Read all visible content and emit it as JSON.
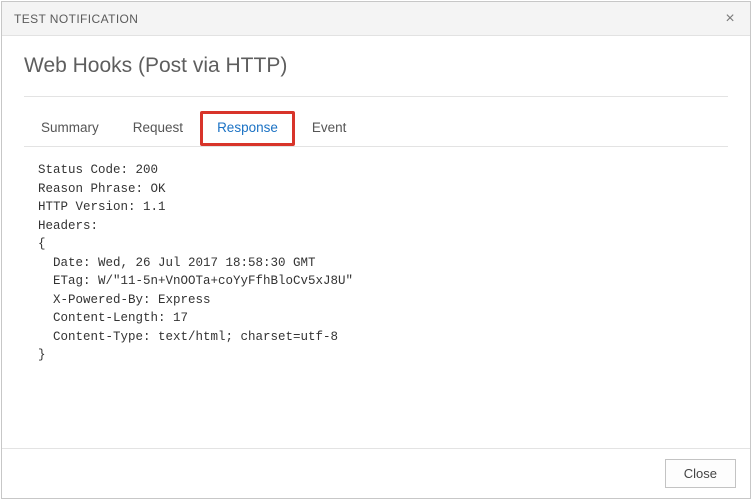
{
  "dialog": {
    "title": "TEST NOTIFICATION",
    "close_glyph": "×",
    "heading": "Web Hooks (Post via HTTP)"
  },
  "tabs": {
    "items": [
      "Summary",
      "Request",
      "Response",
      "Event"
    ],
    "active_index": 2
  },
  "response": {
    "lines": [
      "Status Code: 200",
      "Reason Phrase: OK",
      "HTTP Version: 1.1",
      "Headers:",
      "{",
      "  Date: Wed, 26 Jul 2017 18:58:30 GMT",
      "  ETag: W/\"11-5n+VnOOTa+coYyFfhBloCv5xJ8U\"",
      "  X-Powered-By: Express",
      "  Content-Length: 17",
      "  Content-Type: text/html; charset=utf-8",
      "}"
    ]
  },
  "footer": {
    "close_label": "Close"
  }
}
